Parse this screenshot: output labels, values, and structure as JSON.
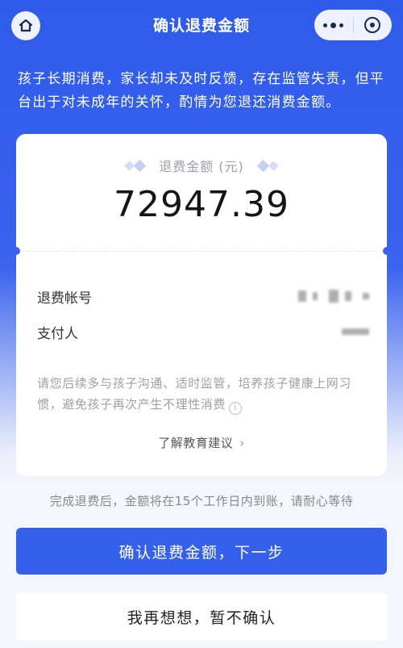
{
  "nav": {
    "title": "确认退费金额",
    "home_icon": "home-icon",
    "more_icon": "more-dots-icon",
    "close_icon": "target-close-icon"
  },
  "notice": "孩子长期消费，家长却未及时反馈，存在监管失责，但平台出于对未成年的关怀，酌情为您退还消费金额。",
  "refund": {
    "label": "退费金额 (元)",
    "amount": "72947.39"
  },
  "details": {
    "account_label": "退费帐号",
    "payer_label": "支付人"
  },
  "hint": {
    "text": "请您后续多与孩子沟通、适时监管，培养孩子健康上网习惯，避免孩子再次产生不理性消费",
    "info_icon": "info-icon"
  },
  "learn_link": {
    "label": "了解教育建议",
    "chevron": "›"
  },
  "footnote": "完成退费后，金额将在15个工作日内到账，请耐心等待",
  "buttons": {
    "confirm": "确认退费金额，下一步",
    "decline": "我再想想，暂不确认"
  },
  "colors": {
    "primary": "#3560ec",
    "background_top": "#2f5bea"
  }
}
